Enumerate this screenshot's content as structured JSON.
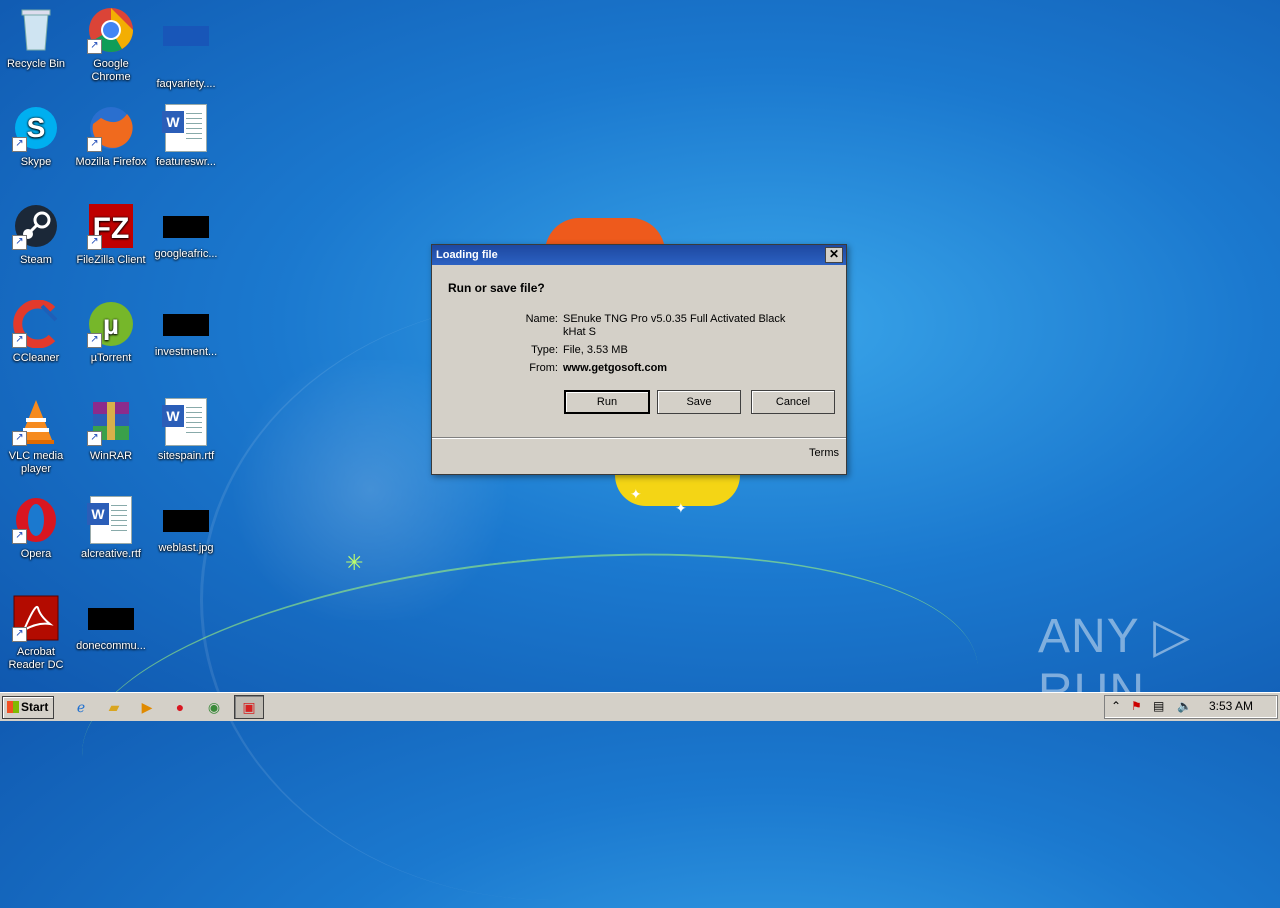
{
  "desktop": {
    "icons": [
      {
        "label": "Recycle Bin"
      },
      {
        "label": "Google Chrome"
      },
      {
        "label": "faqvariety...."
      },
      {
        "label": "Skype"
      },
      {
        "label": "Mozilla Firefox"
      },
      {
        "label": "featureswr..."
      },
      {
        "label": "Steam"
      },
      {
        "label": "FileZilla Client"
      },
      {
        "label": "googleafric..."
      },
      {
        "label": "CCleaner"
      },
      {
        "label": "µTorrent"
      },
      {
        "label": "investment..."
      },
      {
        "label": "VLC media player"
      },
      {
        "label": "WinRAR"
      },
      {
        "label": "sitespain.rtf"
      },
      {
        "label": "Opera"
      },
      {
        "label": "alcreative.rtf"
      },
      {
        "label": "weblast.jpg"
      },
      {
        "label": "Acrobat Reader DC"
      },
      {
        "label": "donecommu..."
      }
    ],
    "watermark": "ANY ▷ RUN"
  },
  "dialog": {
    "title": "Loading file",
    "close_glyph": "✕",
    "heading": "Run or save file?",
    "name_label": "Name:",
    "name_value": "SEnuke TNG Pro v5.0.35 Full Activated  Black kHat S",
    "type_label": "Type:",
    "type_value": "File, 3.53 MB",
    "from_label": "From:",
    "from_value": "www.getgosoft.com",
    "run_label": "Run",
    "save_label": "Save",
    "cancel_label": "Cancel",
    "terms_label": "Terms"
  },
  "taskbar": {
    "start_label": "Start",
    "clock": "3:53 AM"
  }
}
